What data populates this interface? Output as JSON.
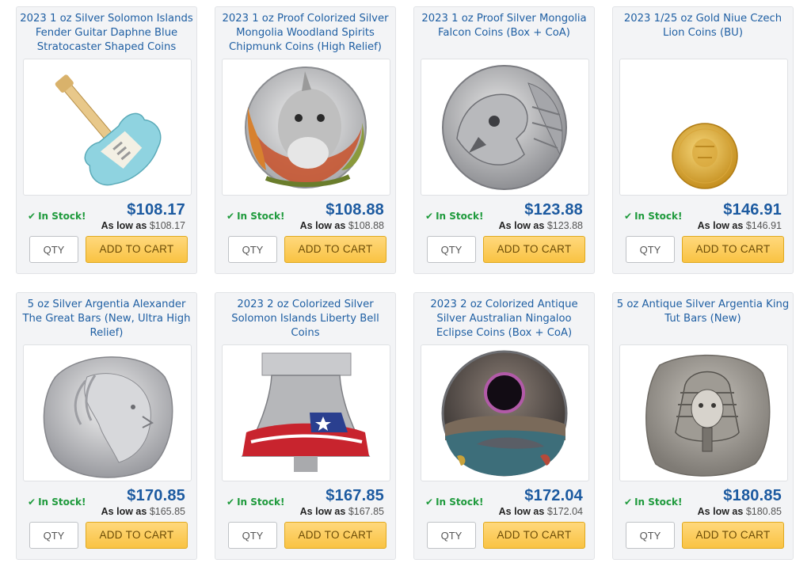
{
  "products": [
    {
      "title": "2023 1 oz Silver Solomon Islands Fender Guitar Daphne Blue Stratocaster Shaped Coins",
      "stock": "In Stock!",
      "price": "$108.17",
      "low_label": "As low as",
      "low_price": "$108.17",
      "qty_placeholder": "QTY",
      "cart_label": "ADD TO CART",
      "image": "guitar-coin-image"
    },
    {
      "title": "2023 1 oz Proof Colorized Silver Mongolia Woodland Spirits Chipmunk Coins (High Relief)",
      "stock": "In Stock!",
      "price": "$108.88",
      "low_label": "As low as",
      "low_price": "$108.88",
      "qty_placeholder": "QTY",
      "cart_label": "ADD TO CART",
      "image": "chipmunk-coin-image"
    },
    {
      "title": "2023 1 oz Proof Silver Mongolia Falcon Coins (Box + CoA)",
      "stock": "In Stock!",
      "price": "$123.88",
      "low_label": "As low as",
      "low_price": "$123.88",
      "qty_placeholder": "QTY",
      "cart_label": "ADD TO CART",
      "image": "falcon-coin-image"
    },
    {
      "title": "2023 1/25 oz Gold Niue Czech Lion Coins (BU)",
      "stock": "In Stock!",
      "price": "$146.91",
      "low_label": "As low as",
      "low_price": "$146.91",
      "qty_placeholder": "QTY",
      "cart_label": "ADD TO CART",
      "image": "lion-gold-coin-image"
    },
    {
      "title": "5 oz Silver Argentia Alexander The Great Bars (New, Ultra High Relief)",
      "stock": "In Stock!",
      "price": "$170.85",
      "low_label": "As low as",
      "low_price": "$165.85",
      "qty_placeholder": "QTY",
      "cart_label": "ADD TO CART",
      "image": "alexander-bar-image"
    },
    {
      "title": "2023 2 oz Colorized Silver Solomon Islands Liberty Bell Coins",
      "stock": "In Stock!",
      "price": "$167.85",
      "low_label": "As low as",
      "low_price": "$167.85",
      "qty_placeholder": "QTY",
      "cart_label": "ADD TO CART",
      "image": "liberty-bell-coin-image"
    },
    {
      "title": "2023 2 oz Colorized Antique Silver Australian Ningaloo Eclipse Coins (Box + CoA)",
      "stock": "In Stock!",
      "price": "$172.04",
      "low_label": "As low as",
      "low_price": "$172.04",
      "qty_placeholder": "QTY",
      "cart_label": "ADD TO CART",
      "image": "eclipse-coin-image"
    },
    {
      "title": "5 oz Antique Silver Argentia King Tut Bars (New)",
      "stock": "In Stock!",
      "price": "$180.85",
      "low_label": "As low as",
      "low_price": "$180.85",
      "qty_placeholder": "QTY",
      "cart_label": "ADD TO CART",
      "image": "king-tut-bar-image"
    }
  ],
  "colors": {
    "title": "#1f5fa3",
    "price": "#1c5aa0",
    "stock": "#1e9a3c",
    "cart_button": "#f9c343"
  }
}
